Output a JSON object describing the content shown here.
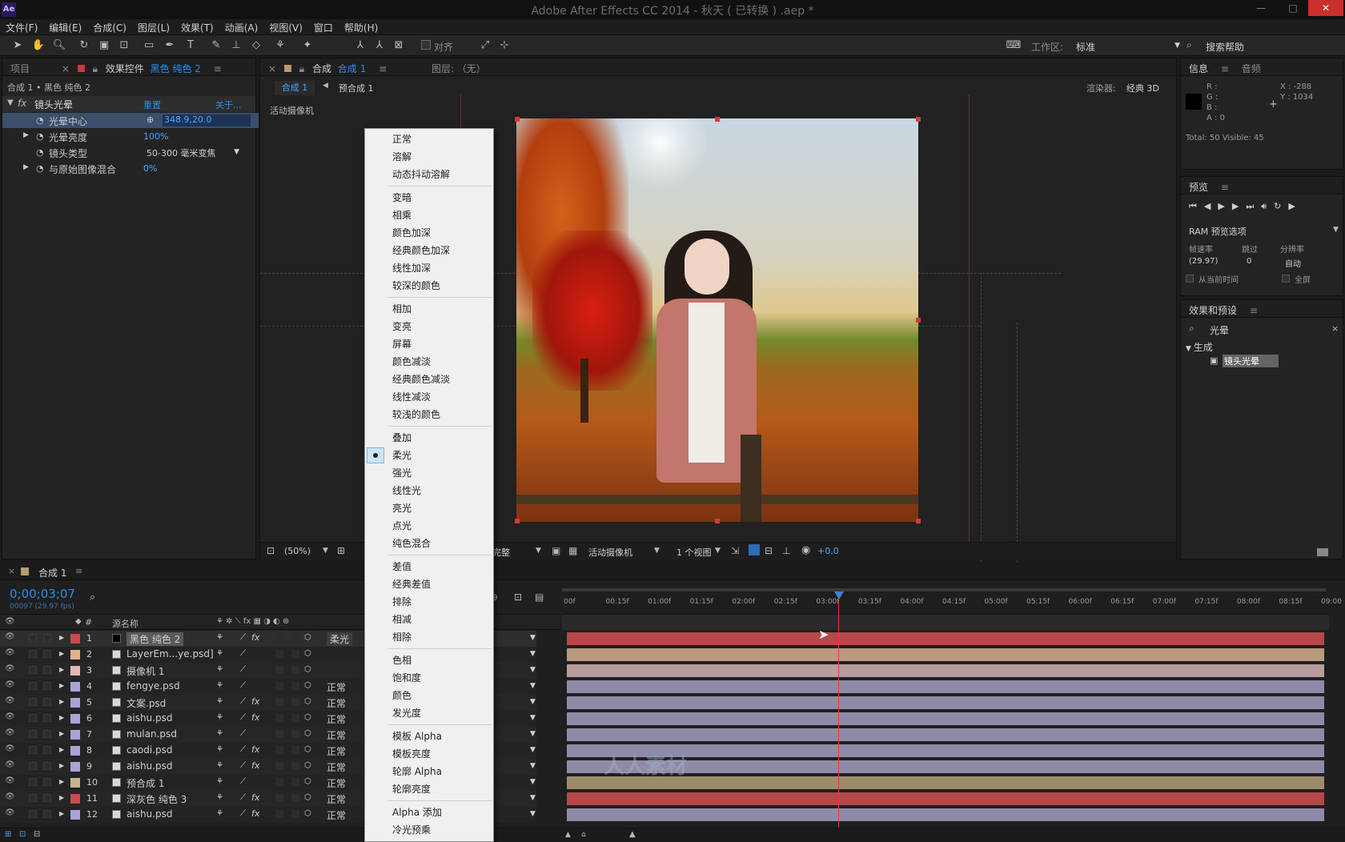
{
  "window": {
    "app_logo": "Ae",
    "title": "Adobe After Effects CC 2014 - 秋天 ( 已转换 ) .aep *",
    "min": "—",
    "max": "□",
    "close": "✕"
  },
  "menubar": [
    "文件(F)",
    "编辑(E)",
    "合成(C)",
    "图层(L)",
    "效果(T)",
    "动画(A)",
    "视图(V)",
    "窗口",
    "帮助(H)"
  ],
  "toolbar": {
    "snap_label": "对齐",
    "workspace_label": "工作区:",
    "workspace_value": "标准",
    "search_help": "搜索帮助"
  },
  "effect_panel": {
    "tab_project": "项目",
    "tab_effects": "效果控件",
    "tab_effects_layer": "黑色 纯色 2",
    "breadcrumb": "合成 1 • 黑色 纯色 2",
    "effect_name": "镜头光晕",
    "reset": "重置",
    "about": "关于...",
    "props": [
      {
        "label": "光晕中心",
        "value": "348.9,20.0"
      },
      {
        "label": "光晕亮度",
        "value": "100%"
      },
      {
        "label": "镜头类型",
        "value": "50-300 毫米变焦"
      },
      {
        "label": "与原始图像混合",
        "value": "0%"
      }
    ]
  },
  "comp_panel": {
    "tab": "合成",
    "tab_name": "合成 1",
    "layer_tab": "图层: （无）",
    "sub_comp1": "合成 1",
    "sub_comp2": "预合成 1",
    "renderer_label": "渲染器:",
    "renderer_value": "经典 3D",
    "camera_label": "活动摄像机",
    "zoom": "(50%)",
    "bottom_quality": "完整",
    "bottom_camera": "活动摄像机",
    "bottom_views": "1 个视图",
    "exposure": "+0.0"
  },
  "blend_menu": {
    "groups": [
      [
        "正常",
        "溶解",
        "动态抖动溶解"
      ],
      [
        "变暗",
        "相乘",
        "颜色加深",
        "经典颜色加深",
        "线性加深",
        "较深的颜色"
      ],
      [
        "相加",
        "变亮",
        "屏幕",
        "颜色减淡",
        "经典颜色减淡",
        "线性减淡",
        "较浅的颜色"
      ],
      [
        "叠加",
        "柔光",
        "强光",
        "线性光",
        "亮光",
        "点光",
        "纯色混合"
      ],
      [
        "差值",
        "经典差值",
        "排除",
        "相减",
        "相除"
      ],
      [
        "色相",
        "饱和度",
        "颜色",
        "发光度"
      ],
      [
        "模板 Alpha",
        "模板亮度",
        "轮廓 Alpha",
        "轮廓亮度"
      ],
      [
        "Alpha 添加",
        "冷光预乘"
      ]
    ],
    "selected": "柔光"
  },
  "info_panel": {
    "tab": "信息",
    "tab2": "音频",
    "r": "R :",
    "g": "G :",
    "b": "B :",
    "a": "A : 0",
    "x": "X : -288",
    "y": "Y : 1034",
    "totals": "Total: 50   Visible: 45"
  },
  "preview_panel": {
    "tab": "预览",
    "ram": "RAM 预览选项",
    "fps_label": "帧速率",
    "skip_label": "跳过",
    "res_label": "分辨率",
    "fps_value": "(29.97)",
    "skip_value": "0",
    "res_value": "自动",
    "from_current": "从当前时间",
    "fullscreen": "全屏"
  },
  "effects_presets": {
    "tab": "效果和预设",
    "search": "光晕",
    "category": "生成",
    "result": "镜头光晕"
  },
  "timeline": {
    "tab": "合成 1",
    "timecode": "0;00;03;07",
    "frame_info": "00097 (29.97 fps)",
    "col_num": "#",
    "col_name": "源名称",
    "ruler": [
      "00f",
      "00:15f",
      "01:00f",
      "01:15f",
      "02:00f",
      "02:15f",
      "03:00f",
      "03:15f",
      "04:00f",
      "04:15f",
      "05:00f",
      "05:15f",
      "06:00f",
      "06:15f",
      "07:00f",
      "07:15f",
      "08:00f",
      "08:15f",
      "09:00"
    ],
    "layers": [
      {
        "num": "1",
        "name": "黑色 纯色 2",
        "mode": "柔光",
        "color": "#c84b4b",
        "track": "#b54848",
        "fx": true
      },
      {
        "num": "2",
        "name": "LayerEm...ye.psd]",
        "mode": "",
        "color": "#e0b48a",
        "track": "#b99a7e",
        "fx": false
      },
      {
        "num": "3",
        "name": "摄像机 1",
        "mode": "",
        "color": "#e4b6b6",
        "track": "#b79d9d",
        "fx": false
      },
      {
        "num": "4",
        "name": "fengye.psd",
        "mode": "正常",
        "color": "#a9a3d6",
        "track": "#8f8aa8",
        "fx": false
      },
      {
        "num": "5",
        "name": "文案.psd",
        "mode": "正常",
        "color": "#a9a3d6",
        "track": "#8f8aa8",
        "fx": true
      },
      {
        "num": "6",
        "name": "aishu.psd",
        "mode": "正常",
        "color": "#a9a3d6",
        "track": "#8f8aa8",
        "fx": true
      },
      {
        "num": "7",
        "name": "mulan.psd",
        "mode": "正常",
        "color": "#a9a3d6",
        "track": "#8f8aa8",
        "fx": false
      },
      {
        "num": "8",
        "name": "caodi.psd",
        "mode": "正常",
        "color": "#a9a3d6",
        "track": "#8f8aa8",
        "fx": true
      },
      {
        "num": "9",
        "name": "aishu.psd",
        "mode": "正常",
        "color": "#a9a3d6",
        "track": "#8f8aa8",
        "fx": true
      },
      {
        "num": "10",
        "name": "预合成 1",
        "mode": "正常",
        "color": "#c9b38e",
        "track": "#9c8c6c",
        "fx": false
      },
      {
        "num": "11",
        "name": "深灰色 纯色 3",
        "mode": "正常",
        "color": "#c84b4b",
        "track": "#b54848",
        "fx": true
      },
      {
        "num": "12",
        "name": "aishu.psd",
        "mode": "正常",
        "color": "#a9a3d6",
        "track": "#8f8aa8",
        "fx": true
      }
    ]
  },
  "watermark": "人人素材"
}
